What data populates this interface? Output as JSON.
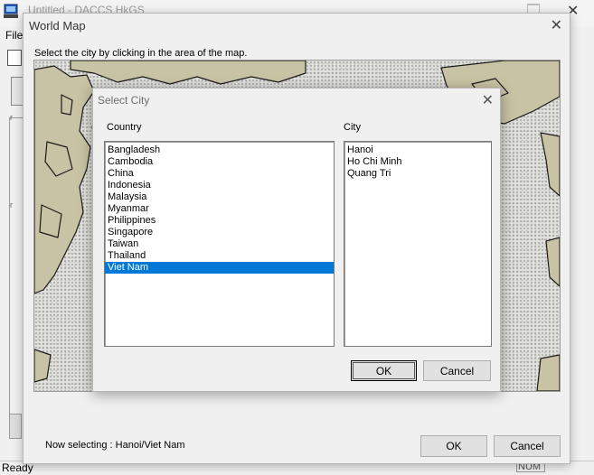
{
  "app": {
    "title": "Untitled - DACCS HkGS",
    "menu_file": "File",
    "status_ready": "Ready",
    "status_num": "NUM"
  },
  "world_map": {
    "title": "World Map",
    "instruction": "Select the city by clicking in the area of the map.",
    "status": "Now selecting : Hanoi/Viet Nam",
    "ok_label": "OK",
    "cancel_label": "Cancel"
  },
  "select_city": {
    "title": "Select City",
    "country_label": "Country",
    "city_label": "City",
    "countries": [
      "Bangladesh",
      "Cambodia",
      "China",
      "Indonesia",
      "Malaysia",
      "Myanmar",
      "Philippines",
      "Singapore",
      "Taiwan",
      "Thailand",
      "Viet Nam"
    ],
    "selected_country": "Viet Nam",
    "cities": [
      "Hanoi",
      "Ho Chi Minh",
      "Quang Tri"
    ],
    "ok_label": "OK",
    "cancel_label": "Cancel"
  },
  "colors": {
    "selection": "#0078d7",
    "land": "#c8c3a4",
    "ocean_stipple": "#e0e0dc",
    "dialog_bg": "#f0f0f0"
  }
}
